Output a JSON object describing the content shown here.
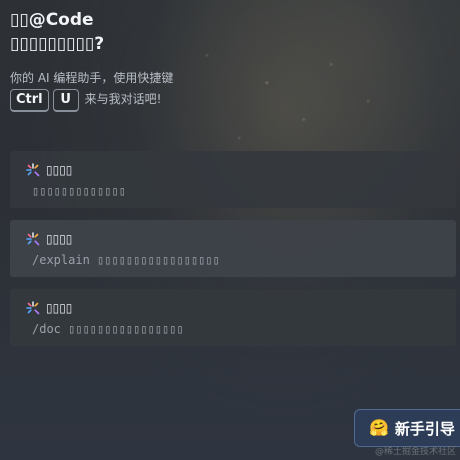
{
  "header": {
    "title_line1": "▯▯@Code",
    "title_line2": "▯▯▯▯▯▯▯▯▯?",
    "subtitle": "你的 AI 编程助手，使用快捷键",
    "shortcut_key1": "Ctrl",
    "shortcut_key2": "U",
    "shortcut_text": "来与我对话吧!"
  },
  "cards": [
    {
      "title": "▯▯▯▯",
      "desc": "▯▯▯▯▯▯▯▯▯▯▯▯▯"
    },
    {
      "title": "▯▯▯▯",
      "desc": "/explain ▯▯▯▯▯▯▯▯▯▯▯▯▯▯▯▯▯"
    },
    {
      "title": "▯▯▯▯",
      "desc": "/doc ▯▯▯▯▯▯▯▯▯▯▯▯▯▯▯▯"
    }
  ],
  "guide_button": {
    "icon": "hugging-face-emoji",
    "label": "新手引导"
  },
  "watermark": "@稀土掘金技术社区",
  "colors": {
    "background": "#2d3136",
    "card": "#34383e",
    "button": "#2e3d57",
    "button_border": "#4f6b95"
  }
}
